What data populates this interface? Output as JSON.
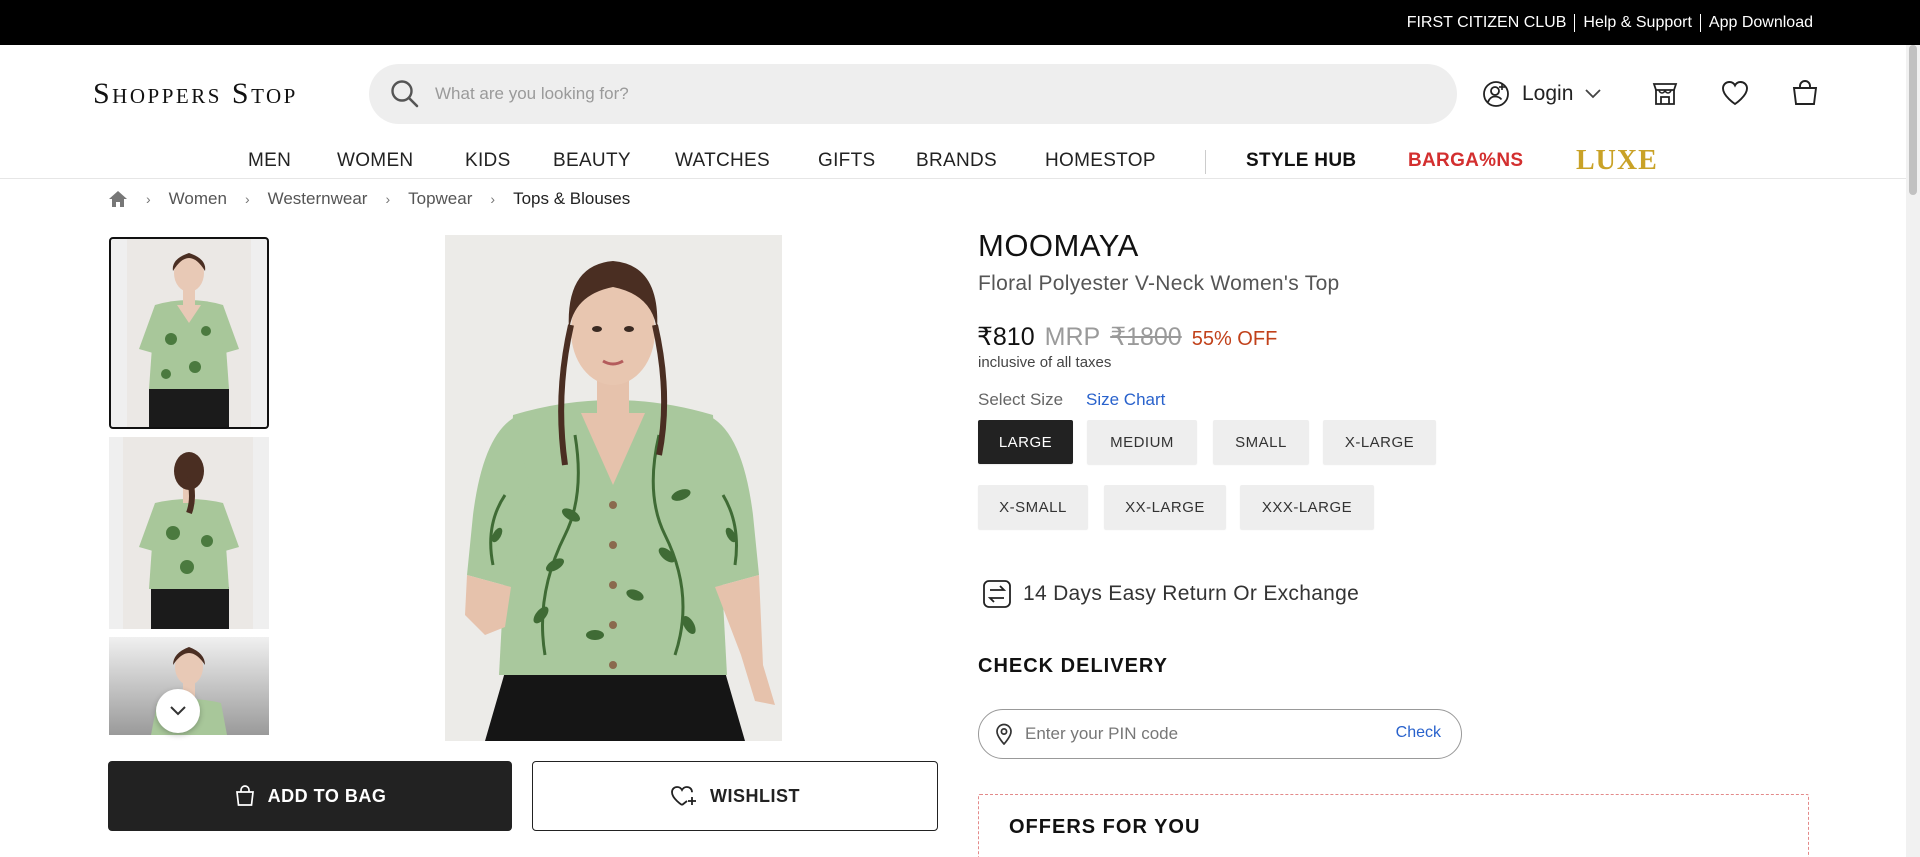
{
  "topbar": {
    "links": [
      "FIRST CITIZEN CLUB",
      "Help & Support",
      "App Download"
    ]
  },
  "header": {
    "logo": "Shoppers Stop",
    "search_placeholder": "What are you looking for?",
    "login_label": "Login"
  },
  "nav": {
    "items": [
      "MEN",
      "WOMEN",
      "KIDS",
      "BEAUTY",
      "WATCHES",
      "GIFTS",
      "BRANDS",
      "HOMESTOP"
    ],
    "style_hub": "STYLE HUB",
    "bargains": "BARGA%NS",
    "luxe": "LUXE"
  },
  "breadcrumb": [
    "Women",
    "Westernwear",
    "Topwear",
    "Tops & Blouses"
  ],
  "product": {
    "brand": "MOOMAYA",
    "title": "Floral Polyester V-Neck Women's Top",
    "price": "₹810",
    "mrp_label": "MRP",
    "mrp": "₹1800",
    "discount": "55% OFF",
    "taxes_note": "inclusive of all taxes",
    "select_size_label": "Select Size",
    "size_chart_label": "Size Chart",
    "sizes": [
      "LARGE",
      "MEDIUM",
      "SMALL",
      "X-LARGE",
      "X-SMALL",
      "XX-LARGE",
      "XXX-LARGE"
    ],
    "selected_size": "LARGE",
    "returns_text": "14 Days Easy Return Or Exchange"
  },
  "actions": {
    "add_to_bag": "ADD TO BAG",
    "wishlist": "WISHLIST"
  },
  "delivery": {
    "heading": "CHECK DELIVERY",
    "pin_placeholder": "Enter your PIN code",
    "check_label": "Check"
  },
  "offers": {
    "heading": "OFFERS FOR YOU"
  },
  "colors": {
    "topbar_bg": "#000000",
    "accent_red": "#d32f2f",
    "luxe_gold": "#c9a227",
    "link_blue": "#2962cc",
    "discount_orange": "#c1411a",
    "garment_green": "#a8c79a"
  }
}
